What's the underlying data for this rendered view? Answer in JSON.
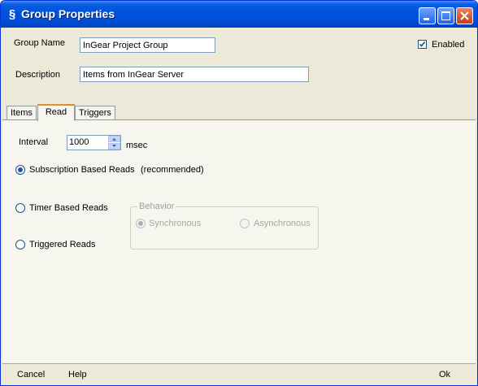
{
  "window": {
    "title": "Group Properties"
  },
  "group_name": {
    "label": "Group Name",
    "value": "InGear Project Group"
  },
  "enabled": {
    "label": "Enabled",
    "checked": true
  },
  "description": {
    "label": "Description",
    "value": "Items from InGear Server"
  },
  "tabs": [
    {
      "label": "Items",
      "active": false
    },
    {
      "label": "Read",
      "active": true
    },
    {
      "label": "Triggers",
      "active": false
    }
  ],
  "read": {
    "interval_label": "Interval",
    "interval_value": "1000",
    "interval_unit": "msec",
    "subscription_label": "Subscription Based Reads",
    "subscription_note": "(recommended)",
    "timer_label": "Timer Based Reads",
    "triggered_label": "Triggered Reads",
    "behavior": {
      "legend": "Behavior",
      "synchronous_label": "Synchronous",
      "asynchronous_label": "Asynchronous"
    }
  },
  "footer": {
    "cancel": "Cancel",
    "help": "Help",
    "ok": "Ok"
  },
  "colors": {
    "titlebar": "#0053dd",
    "dialog_bg": "#ece9d8",
    "active_tab_accent": "#e68b2c"
  }
}
